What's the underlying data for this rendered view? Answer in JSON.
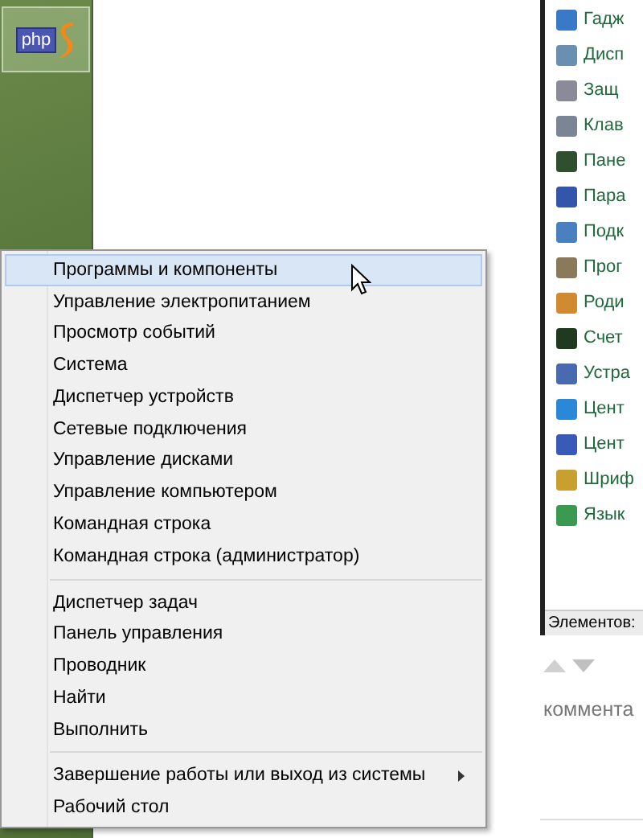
{
  "desktop": {
    "app_icon_text": "php"
  },
  "background_window": {
    "items": [
      {
        "label": "Гадж"
      },
      {
        "label": "Дисп"
      },
      {
        "label": "Защ"
      },
      {
        "label": "Клав"
      },
      {
        "label": "Пане"
      },
      {
        "label": "Пара"
      },
      {
        "label": "Подк"
      },
      {
        "label": "Прог"
      },
      {
        "label": "Роди"
      },
      {
        "label": "Счет"
      },
      {
        "label": "Устра"
      },
      {
        "label": "Цент"
      },
      {
        "label": "Цент"
      },
      {
        "label": "Шриф"
      },
      {
        "label": "Язык"
      }
    ],
    "status": "Элементов:"
  },
  "comments_heading": "коммента",
  "context_menu": {
    "groups": [
      [
        {
          "label": "Программы и компоненты",
          "selected": true,
          "submenu": false
        },
        {
          "label": "Управление электропитанием",
          "selected": false,
          "submenu": false
        },
        {
          "label": "Просмотр событий",
          "selected": false,
          "submenu": false
        },
        {
          "label": "Система",
          "selected": false,
          "submenu": false
        },
        {
          "label": "Диспетчер устройств",
          "selected": false,
          "submenu": false
        },
        {
          "label": "Сетевые подключения",
          "selected": false,
          "submenu": false
        },
        {
          "label": "Управление дисками",
          "selected": false,
          "submenu": false
        },
        {
          "label": "Управление компьютером",
          "selected": false,
          "submenu": false
        },
        {
          "label": "Командная строка",
          "selected": false,
          "submenu": false
        },
        {
          "label": "Командная строка (администратор)",
          "selected": false,
          "submenu": false
        }
      ],
      [
        {
          "label": "Диспетчер задач",
          "selected": false,
          "submenu": false
        },
        {
          "label": "Панель управления",
          "selected": false,
          "submenu": false
        },
        {
          "label": "Проводник",
          "selected": false,
          "submenu": false
        },
        {
          "label": "Найти",
          "selected": false,
          "submenu": false
        },
        {
          "label": "Выполнить",
          "selected": false,
          "submenu": false
        }
      ],
      [
        {
          "label": "Завершение работы или выход из системы",
          "selected": false,
          "submenu": true
        },
        {
          "label": "Рабочий стол",
          "selected": false,
          "submenu": false
        }
      ]
    ]
  }
}
